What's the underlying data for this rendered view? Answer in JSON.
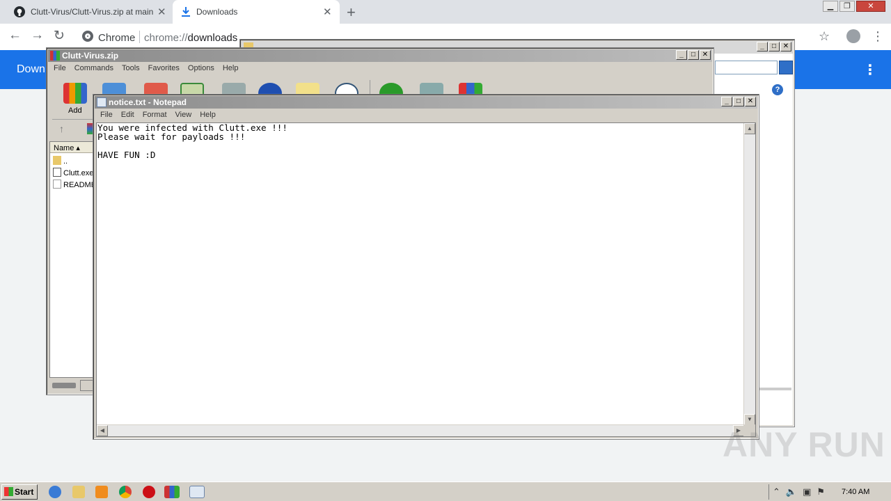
{
  "browser": {
    "tabs": [
      {
        "title": "Clutt-Virus/Clutt-Virus.zip at main · N"
      },
      {
        "title": "Downloads"
      }
    ],
    "omnibox_scheme": "Chrome",
    "omnibox_url_prefix": "chrome://",
    "omnibox_url_host": "downloads",
    "page_title": "Down"
  },
  "winrar": {
    "title": "Clutt-Virus.zip",
    "menu": [
      "File",
      "Commands",
      "Tools",
      "Favorites",
      "Options",
      "Help"
    ],
    "add_label": "Add",
    "column_name": "Name",
    "files": [
      "..",
      "Clutt.exe",
      "README"
    ]
  },
  "notepad": {
    "title": "notice.txt - Notepad",
    "menu": [
      "File",
      "Edit",
      "Format",
      "View",
      "Help"
    ],
    "content": "You were infected with Clutt.exe !!!\nPlease wait for payloads !!!\n\nHAVE FUN :D"
  },
  "watermark": "ANY RUN",
  "taskbar": {
    "start_label": "Start",
    "clock": "7:40 AM"
  },
  "colors": {
    "chrome_blue": "#1a73e8",
    "window_face": "#d4d0c8",
    "close_red": "#c9463d"
  },
  "icons": [
    "github-icon",
    "download-icon",
    "chrome-shield-icon",
    "star-icon",
    "profile-icon",
    "kebab-menu-icon",
    "winrar-icon",
    "notepad-icon",
    "folder-icon",
    "exe-icon",
    "text-file-icon",
    "start-flag-icon",
    "ie-icon",
    "explorer-icon",
    "media-player-icon",
    "chrome-icon",
    "opera-icon"
  ]
}
